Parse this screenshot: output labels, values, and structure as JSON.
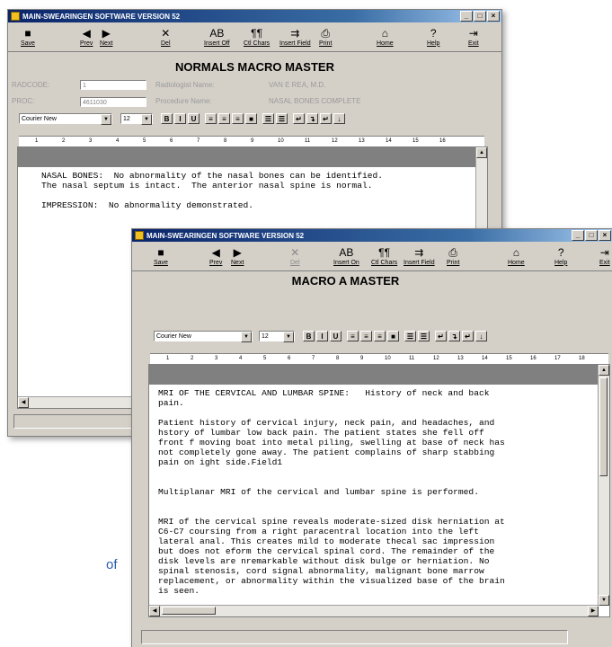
{
  "win1": {
    "title": "MAIN-SWEARINGEN SOFTWARE VERSION 52",
    "ctrls": [
      "_",
      "□",
      "×"
    ],
    "toolbar": [
      {
        "icon": "■",
        "label": "Save",
        "name": "save-button"
      },
      {
        "icon": "◀",
        "label": "Prev",
        "name": "prev-button"
      },
      {
        "icon": "▶",
        "label": "Next",
        "name": "next-button"
      },
      {
        "icon": "✕",
        "label": "Del",
        "name": "delete-button"
      },
      {
        "icon": "AB",
        "label": "Insert Off",
        "name": "insert-off-button"
      },
      {
        "icon": "¶¶",
        "label": "Ctl Chars",
        "name": "ctl-chars-button"
      },
      {
        "icon": "⇉",
        "label": "Insert Field",
        "name": "insert-field-button"
      },
      {
        "icon": "⎙",
        "label": "Print",
        "name": "print-button"
      },
      {
        "icon": "⌂",
        "label": "Home",
        "name": "home-button"
      },
      {
        "icon": "?",
        "label": "Help",
        "name": "help-button"
      },
      {
        "icon": "⇥",
        "label": "Exit",
        "name": "exit-button"
      }
    ],
    "form_title": "NORMALS MACRO MASTER",
    "radcode_label": "RADCODE:",
    "radcode_value": "1",
    "proc_label": "PROC:",
    "proc_value": "4611030",
    "radiologist_label": "Radiologist Name:",
    "radiologist_value": "VAN E REA, M.D.",
    "procedure_label": "Procedure Name:",
    "procedure_value": "NASAL BONES COMPLETE",
    "font_name": "Courier New",
    "font_size": "12",
    "body_text": "NASAL BONES:  No abnormality of the nasal bones can be identified.\nThe nasal septum is intact.  The anterior nasal spine is normal.\n\nIMPRESSION:  No abnormality demonstrated."
  },
  "win2": {
    "title": "MAIN-SWEARINGEN SOFTWARE VERSION 52",
    "ctrls": [
      "_",
      "□",
      "×"
    ],
    "toolbar": [
      {
        "icon": "■",
        "label": "Save",
        "name": "save-button"
      },
      {
        "icon": "◀",
        "label": "Prev",
        "name": "prev-button"
      },
      {
        "icon": "▶",
        "label": "Next",
        "name": "next-button"
      },
      {
        "icon": "✕",
        "label": "Del",
        "name": "delete-button"
      },
      {
        "icon": "AB",
        "label": "Insert On",
        "name": "insert-on-button"
      },
      {
        "icon": "¶¶",
        "label": "Ctl Chars",
        "name": "ctl-chars-button"
      },
      {
        "icon": "⇉",
        "label": "Insert Field",
        "name": "insert-field-button"
      },
      {
        "icon": "⎙",
        "label": "Print",
        "name": "print-button"
      },
      {
        "icon": "⌂",
        "label": "Home",
        "name": "home-button"
      },
      {
        "icon": "?",
        "label": "Help",
        "name": "help-button"
      },
      {
        "icon": "⇥",
        "label": "Exit",
        "name": "exit-button"
      }
    ],
    "form_title": "MACRO A MASTER",
    "font_name": "Courier New",
    "font_size": "12",
    "body_text": "MRI OF THE CERVICAL AND LUMBAR SPINE:   History of neck and back\npain.\n\nPatient history of cervical injury, neck pain, and headaches, and\nhstory of lumbar low back pain. The patient states she fell off\nfront f moving boat into metal piling, swelling at base of neck has\nnot completely gone away. The patient complains of sharp stabbing\npain on ight side.Field1\n\n\nMultiplanar MRI of the cervical and lumbar spine is performed.\n\n\nMRI of the cervical spine reveals moderate-sized disk herniation at\nC6-C7 coursing from a right paracentral location into the left\nlateral anal. This creates mild to moderate thecal sac impression\nbut does not eform the cervical spinal cord. The remainder of the\ndisk levels are nremarkable without disk bulge or herniation. No\nspinal stenosis, cord signal abnormality, malignant bone marrow\nreplacement, or abnormality within the visualized base of the brain\nis seen."
  },
  "format_buttons": [
    "B",
    "I",
    "U",
    "≡",
    "≡",
    "≡",
    "■",
    "☰",
    "☰",
    "↵",
    "↴",
    "↵",
    "↓"
  ],
  "ruler_marks": [
    "1",
    "2",
    "3",
    "4",
    "5",
    "6",
    "7",
    "8",
    "9",
    "10",
    "11",
    "12",
    "13",
    "14",
    "15",
    "16",
    "17",
    "18"
  ],
  "side_text": "of"
}
